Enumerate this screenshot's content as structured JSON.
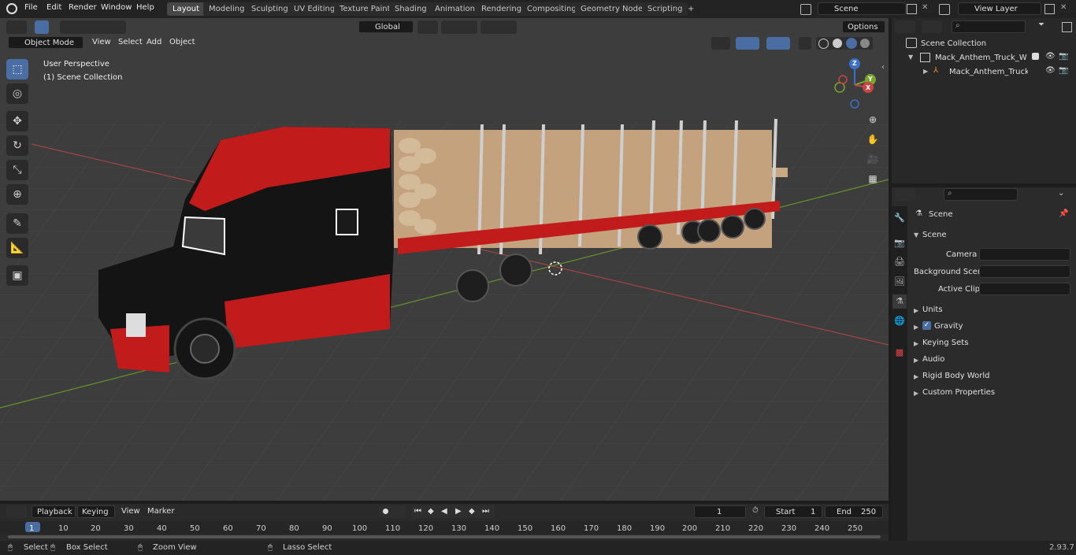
{
  "menubar": {
    "items": [
      "File",
      "Edit",
      "Render",
      "Window",
      "Help"
    ]
  },
  "workspaces": {
    "tabs": [
      "Layout",
      "Modeling",
      "Sculpting",
      "UV Editing",
      "Texture Paint",
      "Shading",
      "Animation",
      "Rendering",
      "Compositing",
      "Geometry Nodes",
      "Scripting"
    ],
    "active": "Layout",
    "add_label": "+"
  },
  "scene_selector": {
    "value": "Scene"
  },
  "view_layer_selector": {
    "value": "View Layer"
  },
  "header": {
    "transform_orientation": "Global",
    "options_label": "Options",
    "mode": "Object Mode",
    "menus": [
      "View",
      "Select",
      "Add",
      "Object"
    ]
  },
  "viewport": {
    "perspective_label": "User Perspective",
    "collection_label": "(1) Scene Collection",
    "gizmo_axes": {
      "z": "Z",
      "y": "Y",
      "x": "X"
    },
    "colors": {
      "x_axis": "#b04545",
      "y_axis": "#6b9a2c",
      "background": "#3d3d3d",
      "grid": "#4a4a4a"
    }
  },
  "outliner": {
    "root": "Scene Collection",
    "items": [
      {
        "label": "Mack_Anthem_Truck_With_Lo",
        "level": 1
      },
      {
        "label": "Mack_Anthem_Truck_Wit",
        "level": 2
      }
    ]
  },
  "properties": {
    "context": "Scene",
    "panel_title": "Scene",
    "fields": [
      {
        "label": "Camera",
        "value": ""
      },
      {
        "label": "Background Scene",
        "value": ""
      },
      {
        "label": "Active Clip",
        "value": ""
      }
    ],
    "sections": [
      "Units",
      "Gravity",
      "Keying Sets",
      "Audio",
      "Rigid Body World",
      "Custom Properties"
    ]
  },
  "timeline": {
    "menus": [
      "Playback",
      "Keying",
      "View",
      "Marker"
    ],
    "current_frame": "1",
    "start_label": "Start",
    "start_value": "1",
    "end_label": "End",
    "end_value": "250",
    "ruler": [
      "1",
      "10",
      "20",
      "30",
      "40",
      "50",
      "60",
      "70",
      "80",
      "90",
      "100",
      "110",
      "120",
      "130",
      "140",
      "150",
      "160",
      "170",
      "180",
      "190",
      "200",
      "210",
      "220",
      "230",
      "240",
      "250"
    ]
  },
  "statusbar": {
    "items": [
      "Select",
      "Box Select",
      "Zoom View",
      "Lasso Select"
    ],
    "version": "2.93.7"
  }
}
